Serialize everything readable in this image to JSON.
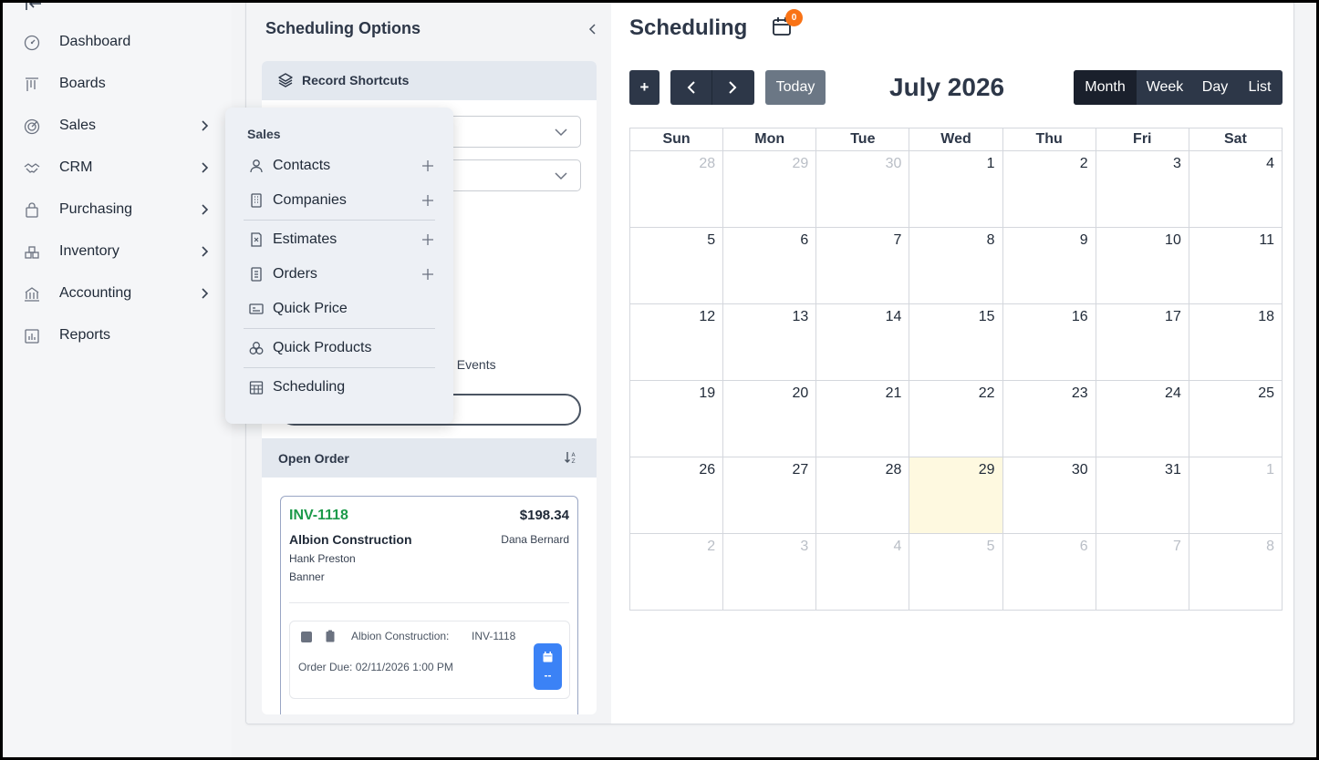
{
  "sidebar": {
    "items": [
      {
        "label": "Dashboard",
        "icon": "dashboard-icon"
      },
      {
        "label": "Boards",
        "icon": "boards-icon"
      },
      {
        "label": "Sales",
        "icon": "sales-icon"
      },
      {
        "label": "CRM",
        "icon": "crm-icon"
      },
      {
        "label": "Purchasing",
        "icon": "purchasing-icon"
      },
      {
        "label": "Inventory",
        "icon": "inventory-icon"
      },
      {
        "label": "Accounting",
        "icon": "accounting-icon"
      },
      {
        "label": "Reports",
        "icon": "reports-icon"
      }
    ]
  },
  "options": {
    "title": "Scheduling Options",
    "shortcuts_label": "Record Shortcuts",
    "events_partial": ": Events",
    "open_order_label": "Open Order"
  },
  "order": {
    "number": "INV-1118",
    "amount": "$198.34",
    "company": "Albion Construction",
    "rep": "Dana Bernard",
    "contact": "Hank Preston",
    "tag": "Banner",
    "event_company": "Albion Construction:",
    "event_invoice": "INV-1118",
    "event_due": "Order Due: 02/11/2026 1:00 PM",
    "event_dashes": "--"
  },
  "calendar": {
    "title": "Scheduling",
    "notification_count": "0",
    "add_label": "+",
    "today_label": "Today",
    "month_title": "July 2026",
    "views": [
      "Month",
      "Week",
      "Day",
      "List"
    ],
    "active_view": "Month",
    "weekdays": [
      "Sun",
      "Mon",
      "Tue",
      "Wed",
      "Thu",
      "Fri",
      "Sat"
    ],
    "weeks": [
      [
        "28",
        "29",
        "30",
        "1",
        "2",
        "3",
        "4"
      ],
      [
        "5",
        "6",
        "7",
        "8",
        "9",
        "10",
        "11"
      ],
      [
        "12",
        "13",
        "14",
        "15",
        "16",
        "17",
        "18"
      ],
      [
        "19",
        "20",
        "21",
        "22",
        "23",
        "24",
        "25"
      ],
      [
        "26",
        "27",
        "28",
        "29",
        "30",
        "31",
        "1"
      ],
      [
        "2",
        "3",
        "4",
        "5",
        "6",
        "7",
        "8"
      ]
    ],
    "today": "29"
  },
  "sales_menu": {
    "title": "Sales",
    "items": [
      {
        "label": "Contacts",
        "icon": "user-icon",
        "has_add": true
      },
      {
        "label": "Companies",
        "icon": "building-icon",
        "has_add": true
      },
      {
        "label": "Estimates",
        "icon": "estimate-icon",
        "has_add": true
      },
      {
        "label": "Orders",
        "icon": "order-icon",
        "has_add": true
      },
      {
        "label": "Quick Price",
        "icon": "price-tag-icon",
        "has_add": false
      },
      {
        "label": "Quick Products",
        "icon": "products-icon",
        "has_add": false
      },
      {
        "label": "Scheduling",
        "icon": "calendar-grid-icon",
        "has_add": false
      }
    ]
  },
  "colors": {
    "accent_dark": "#2d3748",
    "invoice_green": "#1c9a4a",
    "today_highlight": "#fef9e0",
    "badge_orange": "#f97316",
    "event_blue": "#3b82f6"
  }
}
